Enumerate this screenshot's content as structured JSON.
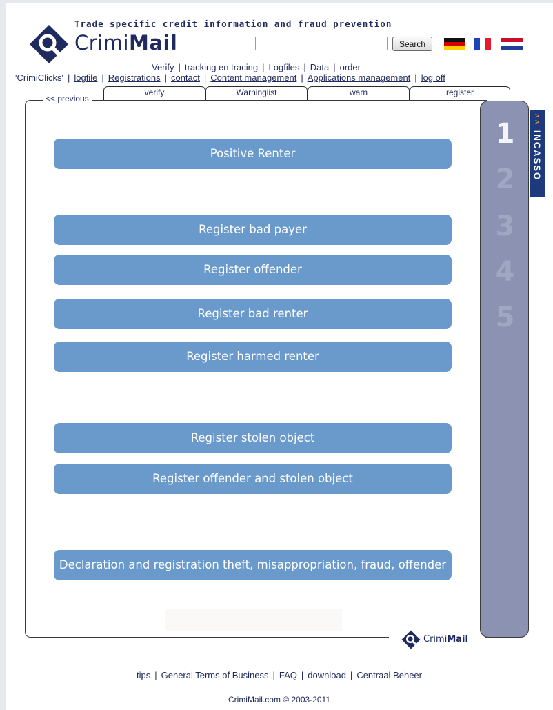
{
  "header": {
    "tagline": "Trade specific credit information and fraud prevention",
    "logo_prefix": "Crimi",
    "logo_suffix": "Mail",
    "search_value": "",
    "search_button": "Search",
    "flags": [
      "flag-de-icon",
      "flag-fr-icon",
      "flag-nl-icon"
    ]
  },
  "nav_row1": [
    "Verify",
    "tracking en tracing",
    "Logfiles",
    "Data",
    "order"
  ],
  "nav_row2": [
    "'CrimiClicks'",
    "logfile",
    "Registrations",
    "contact",
    "Content management",
    "Applications management",
    "log off"
  ],
  "tabs": [
    "verify",
    "Warninglist",
    "warn",
    "register"
  ],
  "previous_link": "<< previous",
  "actions": [
    "Positive Renter",
    "Register bad payer",
    "Register offender",
    "Register bad renter",
    "Register harmed renter",
    "Register stolen object",
    "Register offender and stolen object",
    "Declaration and registration theft, misappropriation, fraud, offender"
  ],
  "steps": [
    "1",
    "2",
    "3",
    "4",
    "5"
  ],
  "incasso": {
    "chevron": ">>",
    "label": "INCASSO"
  },
  "small_logo": {
    "prefix": "Crimi",
    "suffix": "Mail"
  },
  "footer": {
    "links": [
      "tips",
      "General Terms of Business",
      "FAQ",
      "download",
      "Centraal Beheer"
    ],
    "copyright": "CrimiMail.com © 2003-2011"
  },
  "colors": {
    "action_button": "#6a9acb",
    "rail": "#8c92b2",
    "incasso": "#1d3a7c",
    "text": "#1f2a5e"
  }
}
